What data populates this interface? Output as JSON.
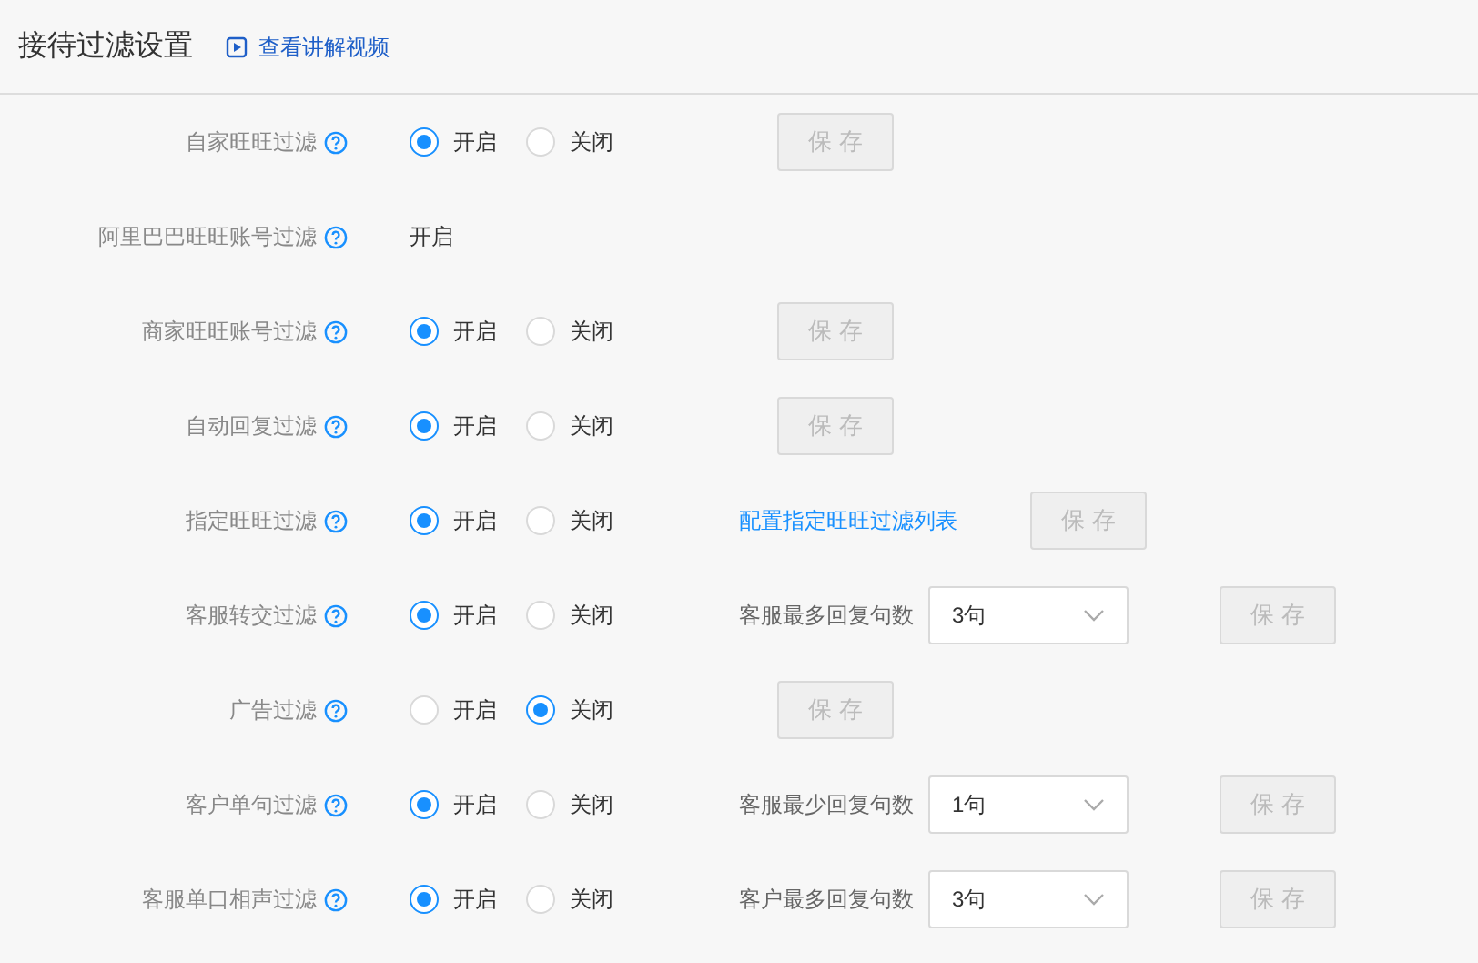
{
  "header": {
    "title": "接待过滤设置",
    "video_link": "查看讲解视频"
  },
  "rows": [
    {
      "kind": "radio",
      "label": "自家旺旺过滤",
      "options": [
        {
          "label": "开启",
          "selected": true
        },
        {
          "label": "关闭",
          "selected": false
        }
      ],
      "save": {
        "label": "保 存",
        "disabled": true
      }
    },
    {
      "kind": "static",
      "label": "阿里巴巴旺旺账号过滤",
      "value": "开启"
    },
    {
      "kind": "radio",
      "label": "商家旺旺账号过滤",
      "options": [
        {
          "label": "开启",
          "selected": true
        },
        {
          "label": "关闭",
          "selected": false
        }
      ],
      "save": {
        "label": "保 存",
        "disabled": true
      }
    },
    {
      "kind": "radio",
      "label": "自动回复过滤",
      "options": [
        {
          "label": "开启",
          "selected": true
        },
        {
          "label": "关闭",
          "selected": false
        }
      ],
      "save": {
        "label": "保 存",
        "disabled": true
      }
    },
    {
      "kind": "radio",
      "label": "指定旺旺过滤",
      "options": [
        {
          "label": "开启",
          "selected": true
        },
        {
          "label": "关闭",
          "selected": false
        }
      ],
      "link": "配置指定旺旺过滤列表",
      "save": {
        "label": "保 存",
        "disabled": true
      }
    },
    {
      "kind": "radio",
      "label": "客服转交过滤",
      "options": [
        {
          "label": "开启",
          "selected": true
        },
        {
          "label": "关闭",
          "selected": false
        }
      ],
      "select": {
        "label": "客服最多回复句数",
        "value": "3句"
      },
      "save": {
        "label": "保 存",
        "disabled": true
      }
    },
    {
      "kind": "radio",
      "label": "广告过滤",
      "options": [
        {
          "label": "开启",
          "selected": false
        },
        {
          "label": "关闭",
          "selected": true
        }
      ],
      "save": {
        "label": "保 存",
        "disabled": true
      }
    },
    {
      "kind": "radio",
      "label": "客户单句过滤",
      "options": [
        {
          "label": "开启",
          "selected": true
        },
        {
          "label": "关闭",
          "selected": false
        }
      ],
      "select": {
        "label": "客服最少回复句数",
        "value": "1句"
      },
      "save": {
        "label": "保 存",
        "disabled": true
      }
    },
    {
      "kind": "radio",
      "label": "客服单口相声过滤",
      "options": [
        {
          "label": "开启",
          "selected": true
        },
        {
          "label": "关闭",
          "selected": false
        }
      ],
      "select": {
        "label": "客户最多回复句数",
        "value": "3句"
      },
      "save": {
        "label": "保 存",
        "disabled": true
      }
    }
  ]
}
